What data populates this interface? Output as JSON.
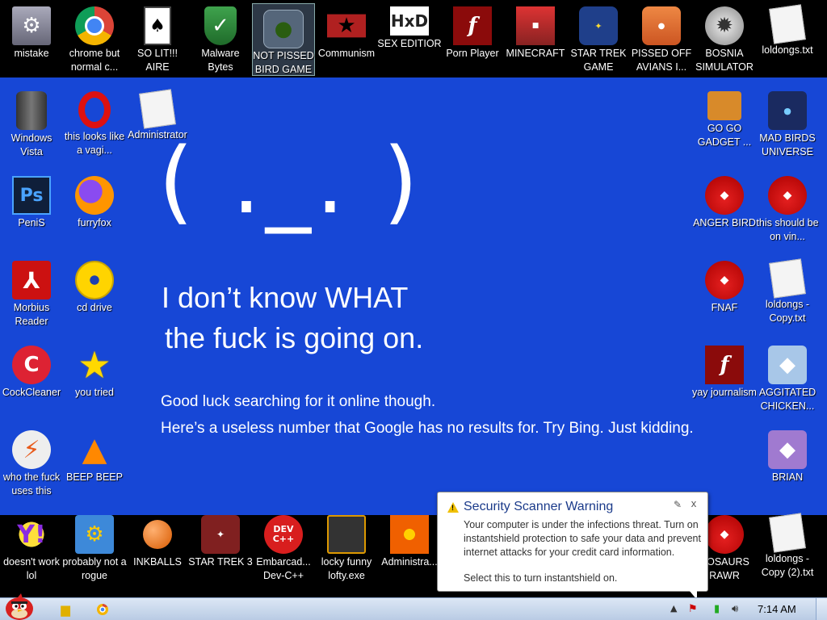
{
  "colors": {
    "desktop": "#1747d6",
    "band": "#000000",
    "popup_title": "#1a3a8a"
  },
  "top_icons": [
    {
      "label": "mistake",
      "icon": "monitor-icon"
    },
    {
      "label": "chrome but normal c...",
      "icon": "chrome-icon"
    },
    {
      "label": "SO LIT!!! AIRE",
      "icon": "cards-icon"
    },
    {
      "label": "Malware Bytes",
      "icon": "shield-icon"
    },
    {
      "label": "NOT PISSED BIRD GAME",
      "icon": "green-bird-icon"
    },
    {
      "label": "Communism",
      "icon": "flag-icon"
    },
    {
      "label": "SEX EDITIOR",
      "icon": "hxd-icon"
    },
    {
      "label": "Porn Player",
      "icon": "flash-icon"
    },
    {
      "label": "MINECRAFT",
      "icon": "minecraft-icon"
    },
    {
      "label": "STAR TREK GAME",
      "icon": "star-trek-icon"
    },
    {
      "label": "PISSED OFF AVIANS I...",
      "icon": "seasons-icon"
    },
    {
      "label": "BOSNIA SIMULATOR",
      "icon": "mine-icon"
    },
    {
      "label": "loldongs.txt",
      "icon": "text-file-icon"
    }
  ],
  "left_icons": [
    {
      "label": "Windows Vista",
      "icon": "trash-can-icon"
    },
    {
      "label": "this looks like a vagi...",
      "icon": "opera-icon"
    },
    {
      "label": "Administrator",
      "icon": "document-icon"
    },
    {
      "label": "PeniS",
      "icon": "photoshop-icon"
    },
    {
      "label": "furryfox",
      "icon": "firefox-icon"
    },
    {
      "label": "Morbius Reader",
      "icon": "pdf-icon"
    },
    {
      "label": "cd drive",
      "icon": "cd-icon"
    },
    {
      "label": "CockCleaner",
      "icon": "ccleaner-icon"
    },
    {
      "label": "you tried",
      "icon": "star-icon"
    },
    {
      "label": "who the fuck uses this",
      "icon": "lightning-icon"
    },
    {
      "label": "BEEP BEEP",
      "icon": "vlc-cone-icon"
    }
  ],
  "bottom_icons": [
    {
      "label": "doesn't work lol",
      "icon": "yahoo-icon"
    },
    {
      "label": "probably not a rogue",
      "icon": "paint-icon"
    },
    {
      "label": "INKBALLS",
      "icon": "ball-icon"
    },
    {
      "label": "STAR TREK 3",
      "icon": "star-trek3-icon"
    },
    {
      "label": "Embarcad... Dev-C++",
      "icon": "devcpp-icon"
    },
    {
      "label": "locky funny lofty.exe",
      "icon": "exe-icon"
    },
    {
      "label": "Administra...",
      "icon": "flower-icon"
    },
    {
      "label": "NOSAURS RAWR",
      "icon": "angry-bird-icon"
    },
    {
      "label": "loldongs - Copy (2).txt",
      "icon": "text-file-icon"
    }
  ],
  "right_icons": [
    {
      "label": "GO GO GADGET ...",
      "icon": "briefcase-icon"
    },
    {
      "label": "MAD BIRDS UNIVERSE",
      "icon": "space-bird-icon"
    },
    {
      "label": "ANGER BIRD",
      "icon": "angry-bird-icon"
    },
    {
      "label": "this should be on vin...",
      "icon": "angry-bird-icon"
    },
    {
      "label": "FNAF",
      "icon": "angry-bird-icon"
    },
    {
      "label": "loldongs - Copy.txt",
      "icon": "text-file-icon"
    },
    {
      "label": "yay journalism",
      "icon": "flash-icon"
    },
    {
      "label": "AGGITATED CHICKEN...",
      "icon": "chicken-icon"
    },
    {
      "label": "BRIAN",
      "icon": "brian-icon"
    }
  ],
  "error_screen": {
    "face": "( ._. )",
    "line1": "I don’t know WHAT",
    "line2": "the fuck is going on.",
    "sub1": "Good luck searching for it online though.",
    "sub2": "Here’s a useless number that Google has no results for. Try Bing. Just kidding."
  },
  "popup": {
    "title": "Security Scanner Warning",
    "body": "Your computer is under the infections threat. Turn on instantshield protection to safe your data and prevent internet attacks for your credit card information.",
    "action": "Select this to turn instantshield on.",
    "close": "x"
  },
  "taskbar": {
    "clock": "7:14 AM",
    "tray_arrow": "▲"
  }
}
